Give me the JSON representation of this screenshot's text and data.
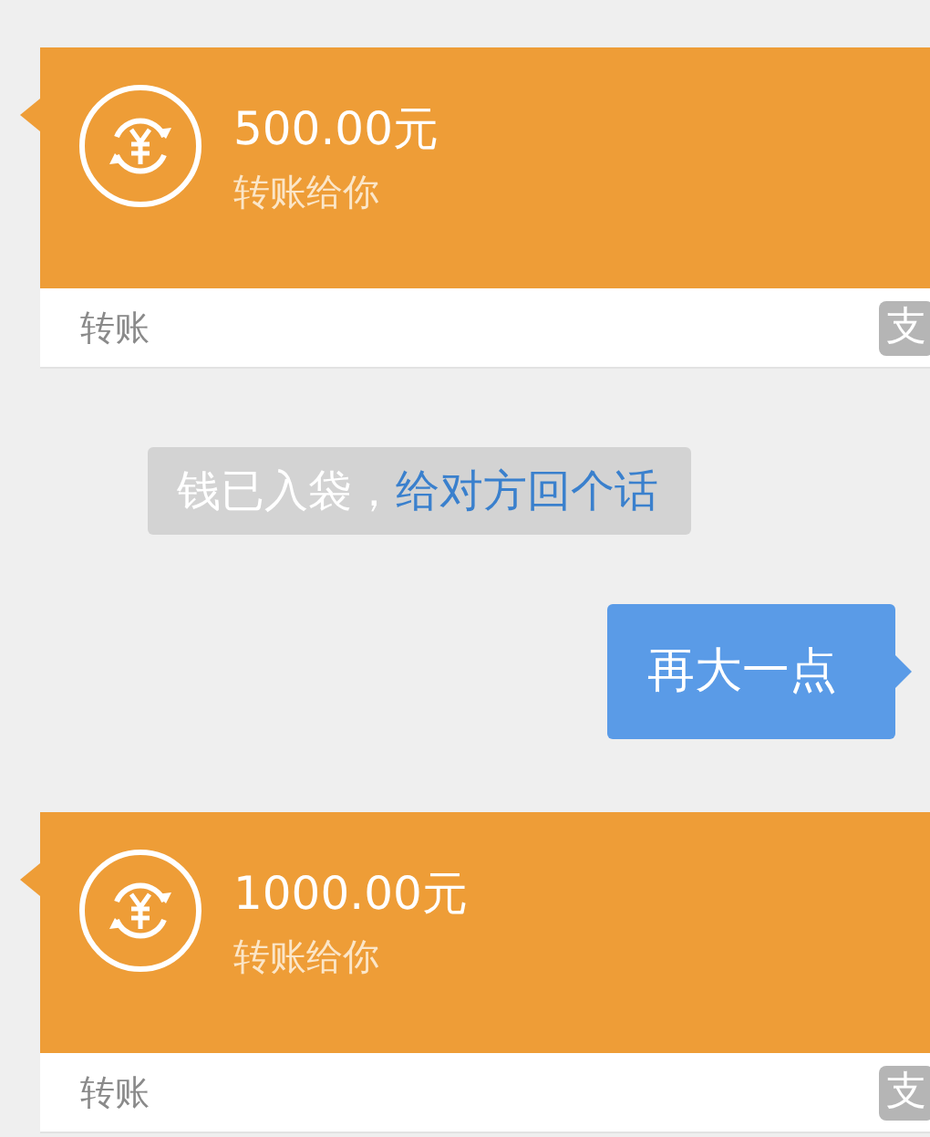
{
  "messages": [
    {
      "kind": "transfer",
      "outgoing": false,
      "amount": "500.00元",
      "caption": "转账给你",
      "footer": "转账",
      "badge": "支"
    },
    {
      "kind": "notice",
      "text": "钱已入袋，",
      "link": "给对方回个话"
    },
    {
      "kind": "text",
      "outgoing": true,
      "text": "再大一点"
    },
    {
      "kind": "transfer",
      "outgoing": false,
      "amount": "1000.00元",
      "caption": "转账给你",
      "footer": "转账",
      "badge": "支"
    }
  ]
}
